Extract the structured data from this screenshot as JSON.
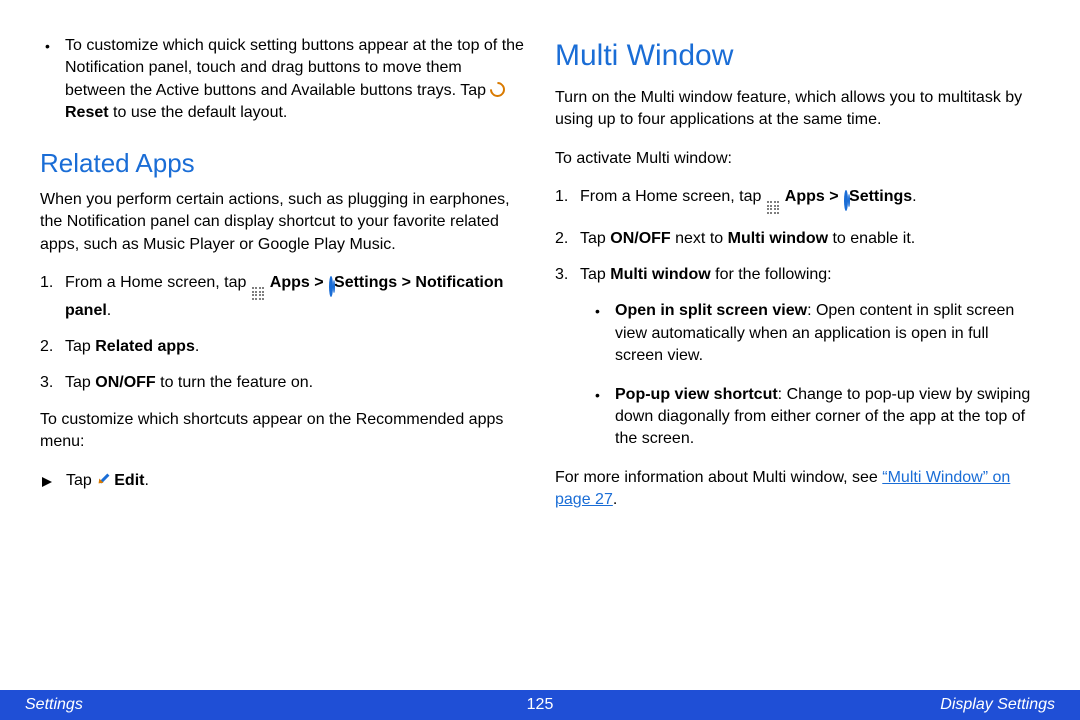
{
  "left": {
    "top_bullet": {
      "text": "To customize which quick setting buttons appear at the top of the Notification panel, touch and drag buttons to move them between the Active buttons and Available buttons trays. Tap ",
      "reset_label": "Reset",
      "tail": " to use the default layout."
    },
    "h2": "Related Apps",
    "intro": "When you perform certain actions, such as plugging in earphones, the Notification panel can display shortcut to your favorite related apps, such as Music Player or Google Play Music.",
    "step1": {
      "pre": "From a Home screen, tap ",
      "apps": "Apps",
      "sep1": " > ",
      "settings": "Settings",
      "sep2": " > ",
      "notif": "Notification panel",
      "tail": "."
    },
    "step2": {
      "pre": "Tap ",
      "bold": "Related apps",
      "tail": "."
    },
    "step3": {
      "pre": "Tap ",
      "bold": "ON/OFF",
      "tail": " to turn the feature on."
    },
    "customize_intro": "To customize which shortcuts appear on the Recommended apps menu:",
    "edit_step": {
      "pre": "Tap ",
      "bold": "Edit",
      "tail": "."
    }
  },
  "right": {
    "h1": "Multi Window",
    "intro": "Turn on the Multi window feature, which allows you to multitask by using up to four applications at the same time.",
    "activate_intro": "To activate Multi window:",
    "step1": {
      "pre": "From a Home screen, tap ",
      "apps": "Apps",
      "sep1": " > ",
      "settings": "Settings",
      "tail": "."
    },
    "step2": {
      "pre": "Tap ",
      "onoff": "ON/OFF",
      "mid": " next to ",
      "mw": "Multi window",
      "tail": " to enable it."
    },
    "step3": {
      "pre": "Tap ",
      "mw": "Multi window",
      "tail": " for the following:"
    },
    "sub1": {
      "bold": "Open in split screen view",
      "text": ": Open content in split screen view automatically when an application is open in full screen view."
    },
    "sub2": {
      "bold": "Pop-up view shortcut",
      "text": ": Change to pop-up view by swiping down diagonally from either corner of the app at the top of the screen."
    },
    "more_info": {
      "pre": "For more information about Multi window, see ",
      "link": "“Multi Window” on page 27",
      "tail": "."
    }
  },
  "footer": {
    "left": "Settings",
    "page": "125",
    "right": "Display Settings"
  }
}
